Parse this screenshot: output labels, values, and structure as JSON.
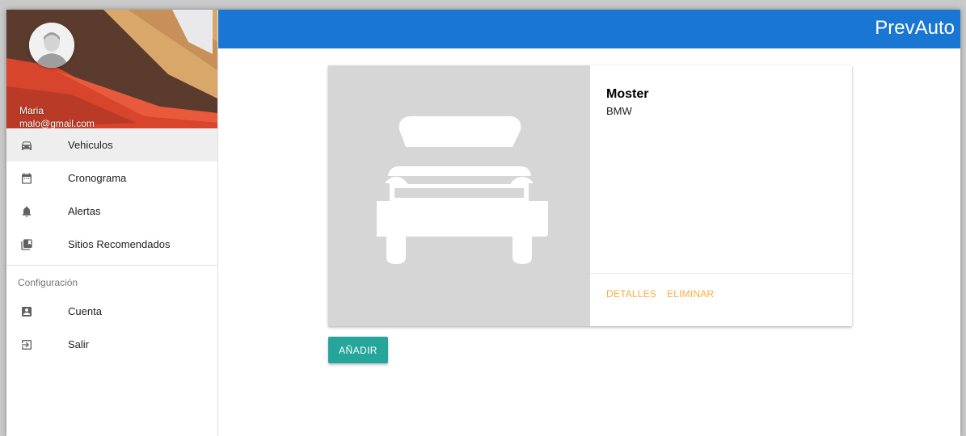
{
  "app": {
    "brand": "PrevAuto",
    "brand_color": "#1976d2"
  },
  "user": {
    "name": "Maria",
    "email": "malo@gmail.com"
  },
  "sidebar": {
    "items": [
      {
        "label": "Vehiculos",
        "icon": "car-icon",
        "active": true
      },
      {
        "label": "Cronograma",
        "icon": "calendar-icon",
        "active": false
      },
      {
        "label": "Alertas",
        "icon": "bell-icon",
        "active": false
      },
      {
        "label": "Sitios Recomendados",
        "icon": "library-icon",
        "active": false
      }
    ],
    "section_label": "Configuración",
    "settings_items": [
      {
        "label": "Cuenta",
        "icon": "account-box-icon"
      },
      {
        "label": "Salir",
        "icon": "exit-icon"
      }
    ]
  },
  "vehicle_card": {
    "name": "Moster",
    "brand": "BMW",
    "image_icon": "car-placeholder-icon",
    "actions": {
      "details": "DETALLES",
      "delete": "ELIMINAR"
    },
    "action_color": "#ffab40"
  },
  "add_button": {
    "label": "AÑADIR",
    "color": "#26a69a"
  }
}
